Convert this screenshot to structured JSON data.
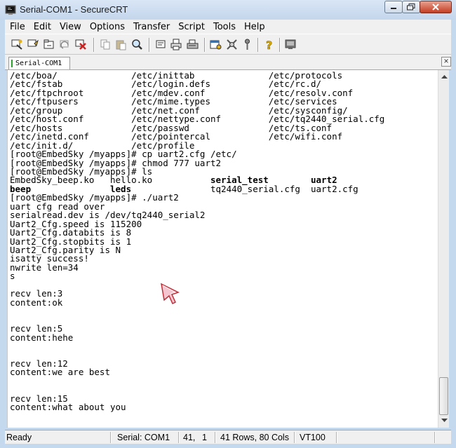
{
  "window": {
    "title": "Serial-COM1 - SecureCRT"
  },
  "menu": [
    "File",
    "Edit",
    "View",
    "Options",
    "Transfer",
    "Script",
    "Tools",
    "Help"
  ],
  "toolbar_icons": [
    "connect-icon",
    "quick-connect-icon",
    "connect-tab-icon",
    "reconnect-icon",
    "disconnect-icon",
    "copy-icon",
    "paste-icon",
    "find-icon",
    "session-properties-icon",
    "print-setup-icon",
    "print-icon",
    "options-icon",
    "keymap-icon",
    "sftp-icon",
    "help-icon",
    "about-icon"
  ],
  "tab": {
    "label": "Serial-COM1"
  },
  "terminal": {
    "lines": [
      [
        {
          "t": "/etc/boa/              /etc/inittab              /etc/protocols"
        }
      ],
      [
        {
          "t": "/etc/fstab             /etc/login.defs           /etc/rc.d/"
        }
      ],
      [
        {
          "t": "/etc/ftpchroot         /etc/mdev.conf            /etc/resolv.conf"
        }
      ],
      [
        {
          "t": "/etc/ftpusers          /etc/mime.types           /etc/services"
        }
      ],
      [
        {
          "t": "/etc/group             /etc/net.conf             /etc/sysconfig/"
        }
      ],
      [
        {
          "t": "/etc/host.conf         /etc/nettype.conf         /etc/tq2440_serial.cfg"
        }
      ],
      [
        {
          "t": "/etc/hosts             /etc/passwd               /etc/ts.conf"
        }
      ],
      [
        {
          "t": "/etc/inetd.conf        /etc/pointercal           /etc/wifi.conf"
        }
      ],
      [
        {
          "t": "/etc/init.d/           /etc/profile"
        }
      ],
      [
        {
          "t": "[root@EmbedSky /myapps]# cp uart2.cfg /etc/"
        }
      ],
      [
        {
          "t": "[root@EmbedSky /myapps]# chmod 777 uart2"
        }
      ],
      [
        {
          "t": "[root@EmbedSky /myapps]# ls"
        }
      ],
      [
        {
          "t": "EmbedSky_beep.ko   hello.ko           "
        },
        {
          "t": "serial_test",
          "b": true
        },
        {
          "t": "        "
        },
        {
          "t": "uart2",
          "b": true
        }
      ],
      [
        {
          "t": "beep",
          "b": true
        },
        {
          "t": "               "
        },
        {
          "t": "leds",
          "b": true
        },
        {
          "t": "               tq2440_serial.cfg  uart2.cfg"
        }
      ],
      [
        {
          "t": "[root@EmbedSky /myapps]# ./uart2"
        }
      ],
      [
        {
          "t": "uart cfg read over"
        }
      ],
      [
        {
          "t": "serialread.dev is /dev/tq2440_serial2"
        }
      ],
      [
        {
          "t": "Uart2_Cfg.speed is 115200"
        }
      ],
      [
        {
          "t": "Uart2_Cfg.databits is 8"
        }
      ],
      [
        {
          "t": "Uart2_Cfg.stopbits is 1"
        }
      ],
      [
        {
          "t": "Uart2_Cfg.parity is N"
        }
      ],
      [
        {
          "t": "isatty success!"
        }
      ],
      [
        {
          "t": "nwrite len=34"
        }
      ],
      [
        {
          "t": "s"
        }
      ],
      [
        {
          "t": ""
        }
      ],
      [
        {
          "t": "recv len:3"
        }
      ],
      [
        {
          "t": "content:ok"
        }
      ],
      [
        {
          "t": ""
        }
      ],
      [
        {
          "t": ""
        }
      ],
      [
        {
          "t": "recv len:5"
        }
      ],
      [
        {
          "t": "content:hehe"
        }
      ],
      [
        {
          "t": ""
        }
      ],
      [
        {
          "t": ""
        }
      ],
      [
        {
          "t": "recv len:12"
        }
      ],
      [
        {
          "t": "content:we are best"
        }
      ],
      [
        {
          "t": ""
        }
      ],
      [
        {
          "t": ""
        }
      ],
      [
        {
          "t": "recv len:15"
        }
      ],
      [
        {
          "t": "content:what about you"
        }
      ]
    ]
  },
  "status": {
    "ready": "Ready",
    "connection": "Serial: COM1",
    "row": "41,",
    "col": "1",
    "size": "41 Rows,  80 Cols",
    "emulation": "VT100"
  }
}
